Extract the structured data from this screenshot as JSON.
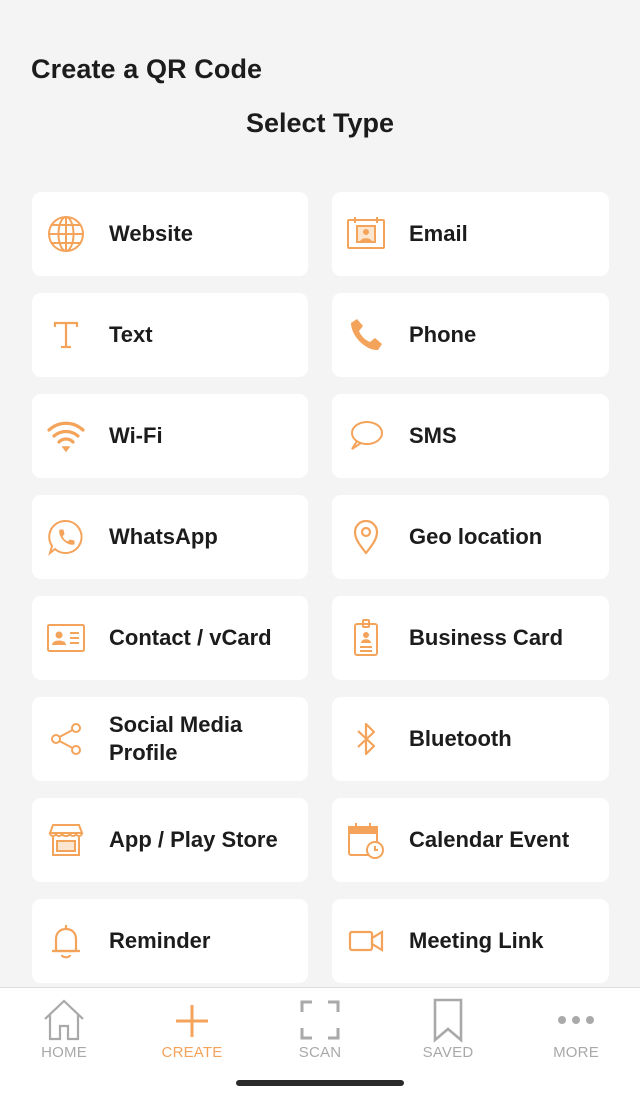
{
  "header": {
    "title": "Create a QR Code",
    "subtitle": "Select Type"
  },
  "accent_color": "#f4a35a",
  "types": [
    {
      "label": "Website",
      "icon": "globe-icon"
    },
    {
      "label": "Email",
      "icon": "email-icon"
    },
    {
      "label": "Text",
      "icon": "text-icon"
    },
    {
      "label": "Phone",
      "icon": "phone-icon"
    },
    {
      "label": "Wi-Fi",
      "icon": "wifi-icon"
    },
    {
      "label": "SMS",
      "icon": "chat-bubble-icon"
    },
    {
      "label": "WhatsApp",
      "icon": "whatsapp-icon"
    },
    {
      "label": "Geo location",
      "icon": "location-pin-icon"
    },
    {
      "label": "Contact / vCard",
      "icon": "contact-card-icon"
    },
    {
      "label": "Business Card",
      "icon": "id-badge-icon"
    },
    {
      "label": "Social Media Profile",
      "icon": "share-icon"
    },
    {
      "label": "Bluetooth",
      "icon": "bluetooth-icon"
    },
    {
      "label": "App / Play Store",
      "icon": "store-icon"
    },
    {
      "label": "Calendar Event",
      "icon": "calendar-clock-icon"
    },
    {
      "label": "Reminder",
      "icon": "bell-icon"
    },
    {
      "label": "Meeting Link",
      "icon": "video-camera-icon"
    }
  ],
  "bottom_nav": [
    {
      "label": "HOME",
      "icon": "home-icon",
      "active": false
    },
    {
      "label": "CREATE",
      "icon": "plus-icon",
      "active": true
    },
    {
      "label": "SCAN",
      "icon": "scan-frame-icon",
      "active": false
    },
    {
      "label": "SAVED",
      "icon": "bookmark-icon",
      "active": false
    },
    {
      "label": "MORE",
      "icon": "more-dots-icon",
      "active": false
    }
  ]
}
